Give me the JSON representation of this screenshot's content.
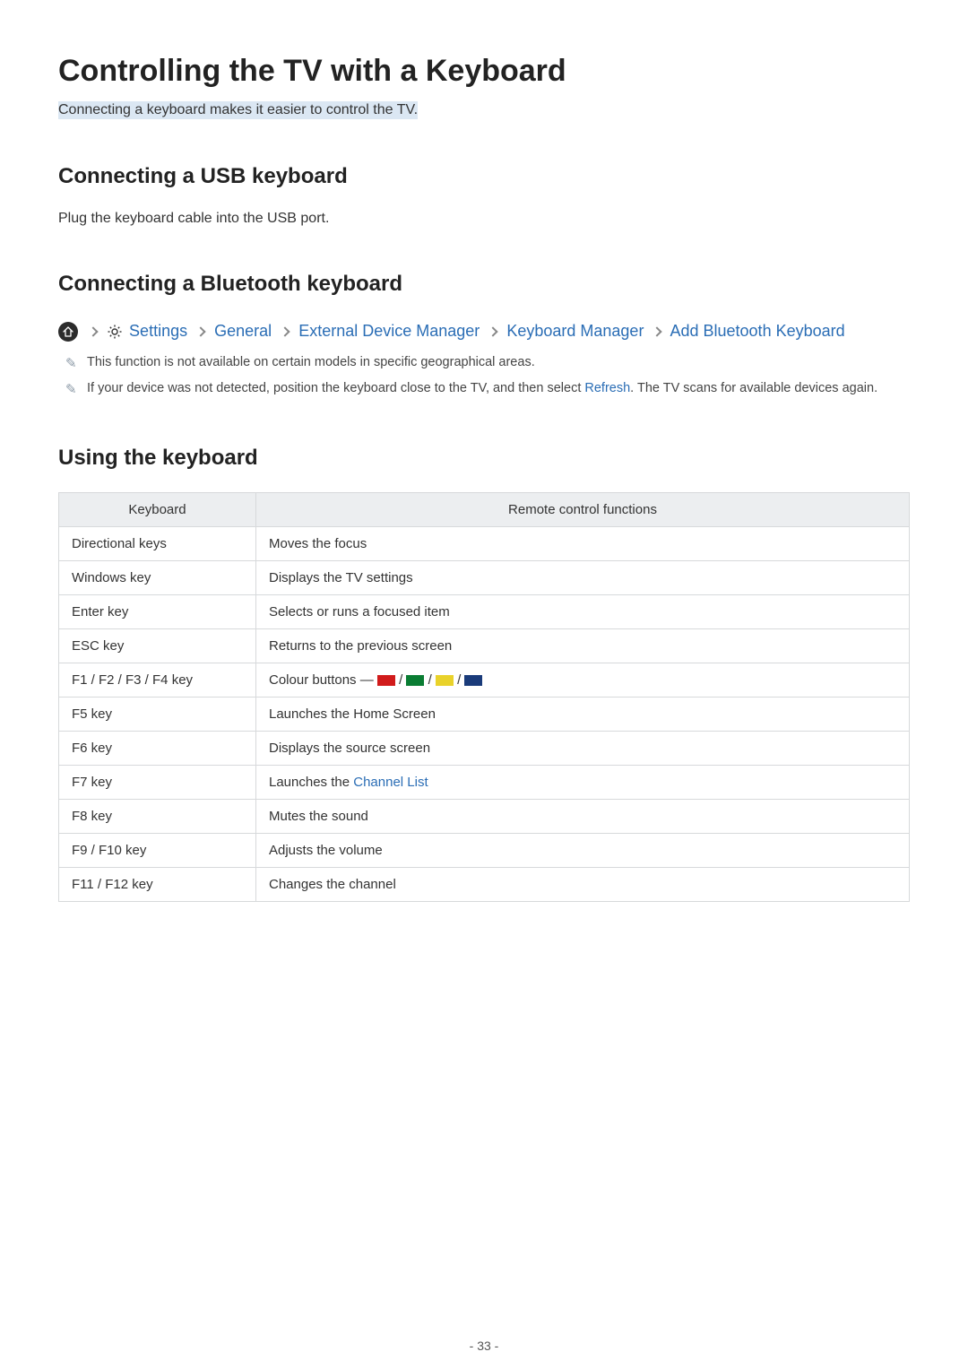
{
  "title": "Controlling the TV with a Keyboard",
  "subtitle": "Connecting a keyboard makes it easier to control the TV.",
  "sections": {
    "usb": {
      "heading": "Connecting a USB keyboard",
      "body": "Plug the keyboard cable into the USB port."
    },
    "bluetooth": {
      "heading": "Connecting a Bluetooth keyboard",
      "path": {
        "settings": "Settings",
        "general": "General",
        "edm": "External Device Manager",
        "keymgr": "Keyboard Manager",
        "addbt": "Add Bluetooth Keyboard"
      },
      "notes": [
        "This function is not available on certain models in specific geographical areas.",
        {
          "pre": "If your device was not detected, position the keyboard close to the TV, and then select ",
          "link": "Refresh",
          "post": ". The TV scans for available devices again."
        }
      ]
    },
    "using": {
      "heading": "Using the keyboard",
      "table": {
        "th1": "Keyboard",
        "th2": "Remote control functions",
        "rows": [
          {
            "k": "Directional keys",
            "f": "Moves the focus"
          },
          {
            "k": "Windows key",
            "f": "Displays the TV settings"
          },
          {
            "k": "Enter key",
            "f": "Selects or runs a focused item"
          },
          {
            "k": "ESC key",
            "f": "Returns to the previous screen"
          },
          {
            "k": "F1 / F2 / F3 / F4 key",
            "f_prefix": "Colour buttons ― "
          },
          {
            "k": "F5 key",
            "f": "Launches the Home Screen"
          },
          {
            "k": "F6 key",
            "f": "Displays the source screen"
          },
          {
            "k": "F7 key",
            "f_prefix": "Launches the ",
            "f_link": "Channel List"
          },
          {
            "k": "F8 key",
            "f": "Mutes the sound"
          },
          {
            "k": "F9 / F10 key",
            "f": "Adjusts the volume"
          },
          {
            "k": "F11 / F12 key",
            "f": "Changes the channel"
          }
        ]
      }
    }
  },
  "page_number": "- 33 -"
}
